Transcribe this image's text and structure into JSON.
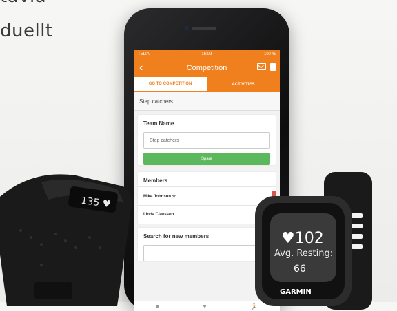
{
  "background_text": {
    "line1": "tävla",
    "line2": "duellt"
  },
  "status_bar": {
    "carrier": "TELIA",
    "time": "16:09",
    "battery": "100 %"
  },
  "nav": {
    "back_icon": "chevron-left-icon",
    "title": "Competition"
  },
  "tabs": [
    {
      "label": "GO TO COMPETITION",
      "active": true
    },
    {
      "label": "ACTIVITIES",
      "active": false
    }
  ],
  "team_title": "Step catchers",
  "team_card": {
    "heading": "Team Name",
    "input_value": "Step catchers",
    "save_label": "Spara"
  },
  "members_card": {
    "heading": "Members",
    "members": [
      {
        "name": "Mike Johnson ☆"
      },
      {
        "name": "Linda Claesson"
      }
    ]
  },
  "search_card": {
    "heading": "Search for new members"
  },
  "fitbit": {
    "display": "135 ♥"
  },
  "garmin": {
    "heart": "102",
    "label": "Avg. Resting:",
    "value": "66",
    "brand": "GARMIN"
  },
  "colors": {
    "accent": "#f07f1d",
    "save": "#5cb85c"
  }
}
